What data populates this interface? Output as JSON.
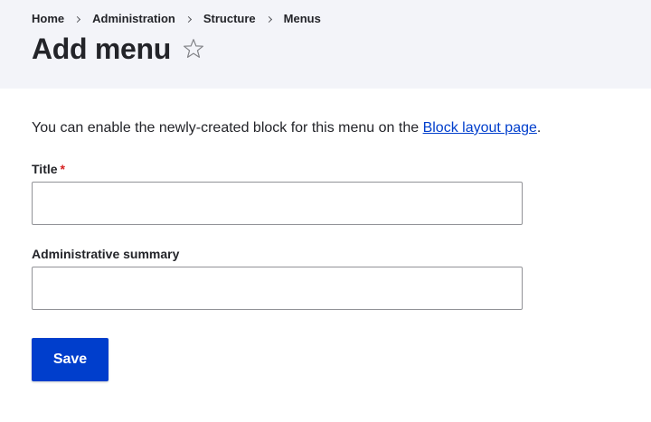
{
  "breadcrumb": {
    "items": [
      "Home",
      "Administration",
      "Structure",
      "Menus"
    ]
  },
  "header": {
    "title": "Add menu",
    "shortcut_icon": "star-outline-icon"
  },
  "main": {
    "intro_text": "You can enable the newly-created block for this menu on the ",
    "intro_link": "Block layout page",
    "intro_suffix": ".",
    "fields": {
      "title_label": "Title",
      "title_required": "*",
      "title_value": "",
      "summary_label": "Administrative summary",
      "summary_value": ""
    },
    "save_label": "Save"
  },
  "colors": {
    "header_bg": "#f3f4f9",
    "primary": "#003ecc",
    "required": "#d72222"
  }
}
